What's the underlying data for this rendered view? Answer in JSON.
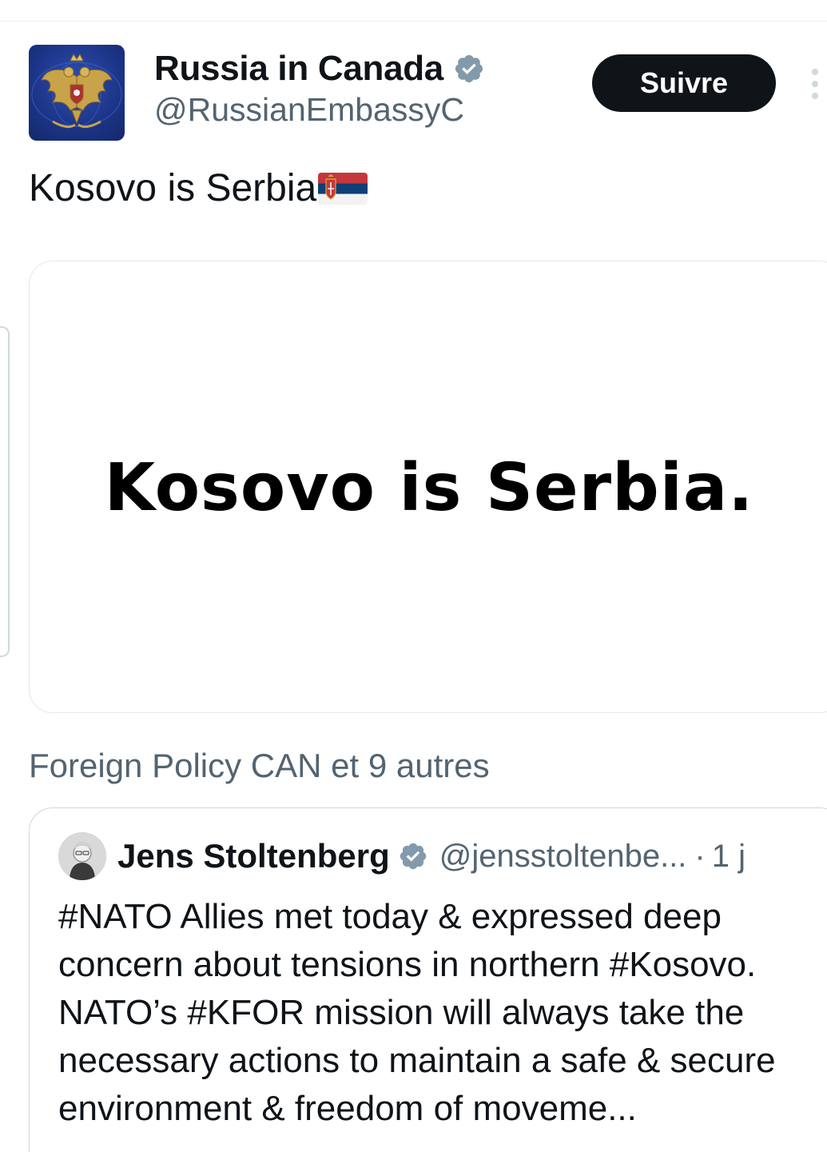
{
  "post": {
    "author": {
      "display_name": "Russia in Canada",
      "handle": "@RussianEmbassyC",
      "verified": true,
      "avatar_icon": "coat-of-arms-icon"
    },
    "follow_label": "Suivre",
    "more_icon": "more-vertical-icon",
    "text": "Kosovo is Serbia",
    "emoji": "serbia-flag-icon",
    "media_text": "Kosovo is Serbia.",
    "social_context": "Foreign Policy CAN et 9 autres"
  },
  "quote": {
    "author": {
      "display_name": "Jens Stoltenberg",
      "handle": "@jensstoltenbe...",
      "verified": true,
      "avatar_icon": "profile-photo-icon"
    },
    "separator": "·",
    "time": "1 j",
    "text": "#NATO Allies met today & expressed deep concern about tensions in northern #Kosovo. NATO’s #KFOR mission will always take the necessary actions to maintain a safe & secure environment & freedom of moveme..."
  },
  "colors": {
    "text_primary": "#0f1419",
    "text_secondary": "#536471",
    "verified_badge": "#829aab",
    "follow_button_bg": "#0f1419",
    "border": "#cfd9de"
  }
}
